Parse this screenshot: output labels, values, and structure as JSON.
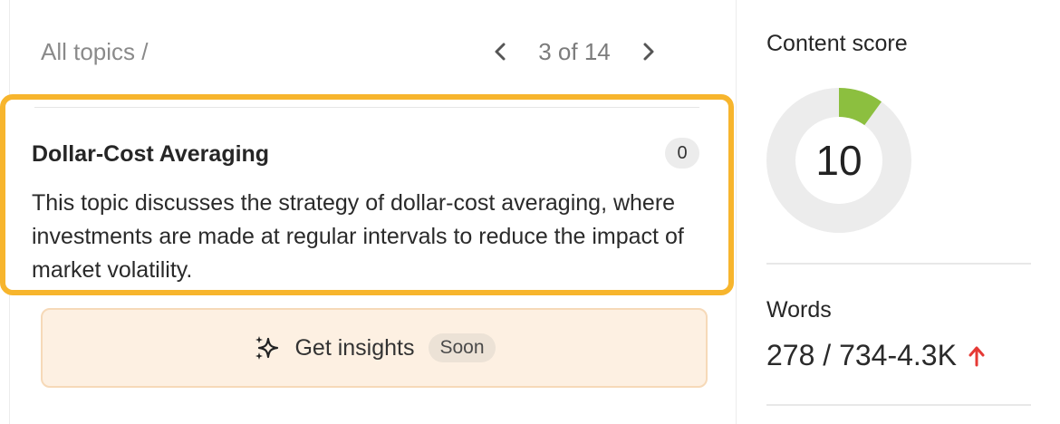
{
  "breadcrumb": {
    "label": "All topics /"
  },
  "pager": {
    "count": "3 of 14",
    "prev_icon": "chevron-left-icon",
    "next_icon": "chevron-right-icon"
  },
  "topic": {
    "title": "Dollar-Cost Averaging",
    "count": "0",
    "description": "This topic discusses the strategy of dollar-cost averaging, where investments are made at regular intervals to reduce the impact of market volatility."
  },
  "insights": {
    "label": "Get insights",
    "badge": "Soon",
    "icon": "sparkle-icon"
  },
  "content_score": {
    "label": "Content score",
    "value": "10",
    "percent": 10,
    "fill_color": "#8cbf3f",
    "track_color": "#ececec"
  },
  "words": {
    "label": "Words",
    "value": "278 / 734-4.3K",
    "trend_icon": "arrow-up-icon",
    "trend_color": "#e53935"
  },
  "colors": {
    "highlight_border": "#f7b52d",
    "insights_bg": "#fdf0e2"
  }
}
